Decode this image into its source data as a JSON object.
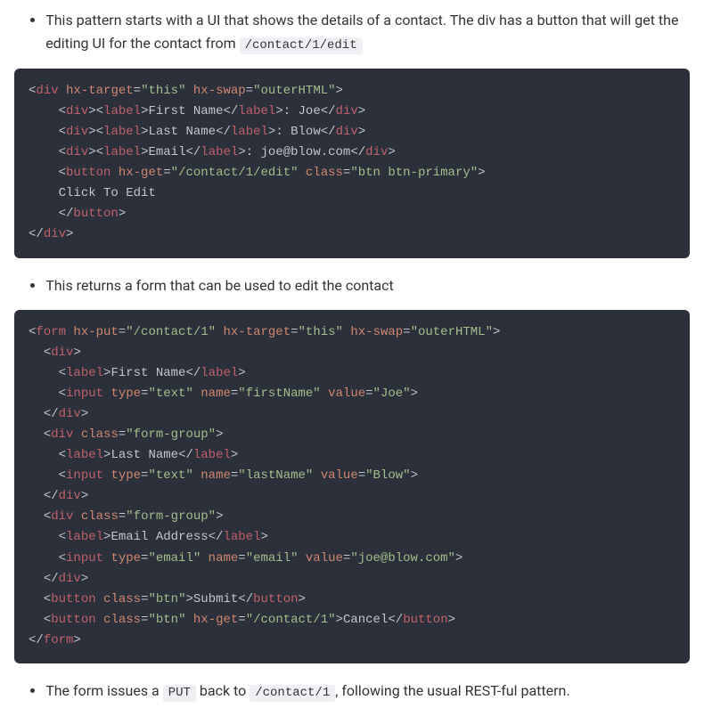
{
  "bullets": [
    {
      "prefix": "This pattern starts with a UI that shows the details of a contact. The div has a button that will get the editing UI for the contact from ",
      "code": "/contact/1/edit",
      "suffix": ""
    },
    {
      "prefix": "This returns a form that can be used to edit the contact",
      "code": "",
      "suffix": ""
    },
    {
      "prefix": "The form issues a ",
      "code": "PUT",
      "mid": " back to ",
      "code2": "/contact/1",
      "suffix": ", following the usual REST-ful pattern."
    }
  ],
  "code1": {
    "div": "div",
    "label": "label",
    "button": "button",
    "hx_target_a": "hx-target",
    "hx_target_v": "\"this\"",
    "hx_swap_a": "hx-swap",
    "hx_swap_v": "\"outerHTML\"",
    "fn_label": "First Name",
    "fn_val": ": Joe",
    "ln_label": "Last Name",
    "ln_val": ": Blow",
    "em_label": "Email",
    "em_val": ": joe@blow.com",
    "hx_get_a": "hx-get",
    "hx_get_v": "\"/contact/1/edit\"",
    "class_a": "class",
    "class_v": "\"btn btn-primary\"",
    "btn_text": "Click To Edit"
  },
  "code2": {
    "form": "form",
    "div": "div",
    "label": "label",
    "input": "input",
    "button": "button",
    "hx_put_a": "hx-put",
    "hx_put_v": "\"/contact/1\"",
    "hx_target_a": "hx-target",
    "hx_target_v": "\"this\"",
    "hx_swap_a": "hx-swap",
    "hx_swap_v": "\"outerHTML\"",
    "class_a": "class",
    "class_fg": "\"form-group\"",
    "class_btn": "\"btn\"",
    "type_a": "type",
    "type_text": "\"text\"",
    "type_email": "\"email\"",
    "name_a": "name",
    "name_fn": "\"firstName\"",
    "name_ln": "\"lastName\"",
    "name_em": "\"email\"",
    "value_a": "value",
    "val_fn": "\"Joe\"",
    "val_ln": "\"Blow\"",
    "val_em": "\"joe@blow.com\"",
    "lbl_fn": "First Name",
    "lbl_ln": "Last Name",
    "lbl_em": "Email Address",
    "btn_submit": "Submit",
    "btn_cancel": "Cancel",
    "hx_get_a": "hx-get",
    "hx_get_v": "\"/contact/1\""
  }
}
